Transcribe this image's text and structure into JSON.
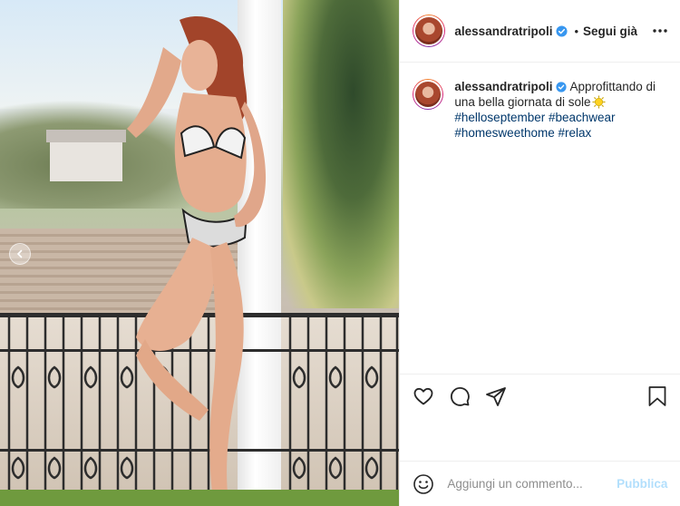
{
  "post": {
    "author": {
      "username": "alessandratripoli",
      "verified": true
    },
    "follow_label": "Segui già",
    "more_options_icon": "more-horizontal-icon",
    "caption": {
      "username": "alessandratripoli",
      "text": "Approfittando di una bella giornata di sole",
      "emoji": "sun-emoji",
      "hashtags": [
        "#helloseptember",
        "#beachwear",
        "#homesweethome",
        "#relax"
      ]
    },
    "actions": {
      "like_icon": "heart-icon",
      "comment_icon": "comment-icon",
      "share_icon": "paper-plane-icon",
      "save_icon": "bookmark-icon"
    },
    "comment_box": {
      "placeholder": "Aggiungi un commento...",
      "emoji_icon": "smiley-icon",
      "publish_label": "Pubblica"
    },
    "media": {
      "prev_icon": "chevron-left-icon"
    }
  },
  "colors": {
    "text": "#262626",
    "hashtag": "#00376b",
    "verified": "#3897f0",
    "publish_disabled": "#b2dffc",
    "border": "#efefef"
  }
}
